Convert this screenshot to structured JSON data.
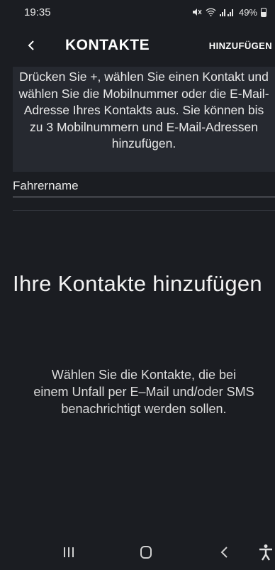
{
  "status_bar": {
    "time": "19:35",
    "signal_text": "🔇 ▿ .❘ .❘",
    "battery": "49%"
  },
  "header": {
    "back_icon": "chevron-left-icon",
    "title": "KONTAKTE",
    "add_label": "HINZUFÜGEN"
  },
  "info": {
    "text": "Drücken Sie +, wählen Sie einen Kontakt und wählen Sie die Mobilnummer oder die E-Mail-Adresse Ihres Kontakts aus. Sie können bis zu 3 Mobilnummern und E-Mail-Adressen hinzufügen."
  },
  "driver_field": {
    "value": "Fahrername"
  },
  "empty_state": {
    "title": "Ihre Kontakte hinzufügen",
    "description": "Wählen Sie die Kontakte, die bei einem Unfall per E–Mail und/oder SMS benachrichtigt werden sollen."
  },
  "nav_bar": {
    "recents_icon": "recent-apps-icon",
    "home_icon": "home-icon",
    "back_icon": "back-icon",
    "accessibility_icon": "accessibility-icon"
  },
  "colors": {
    "background": "#1b1d22",
    "info_background": "#262930",
    "text": "#ffffff"
  }
}
